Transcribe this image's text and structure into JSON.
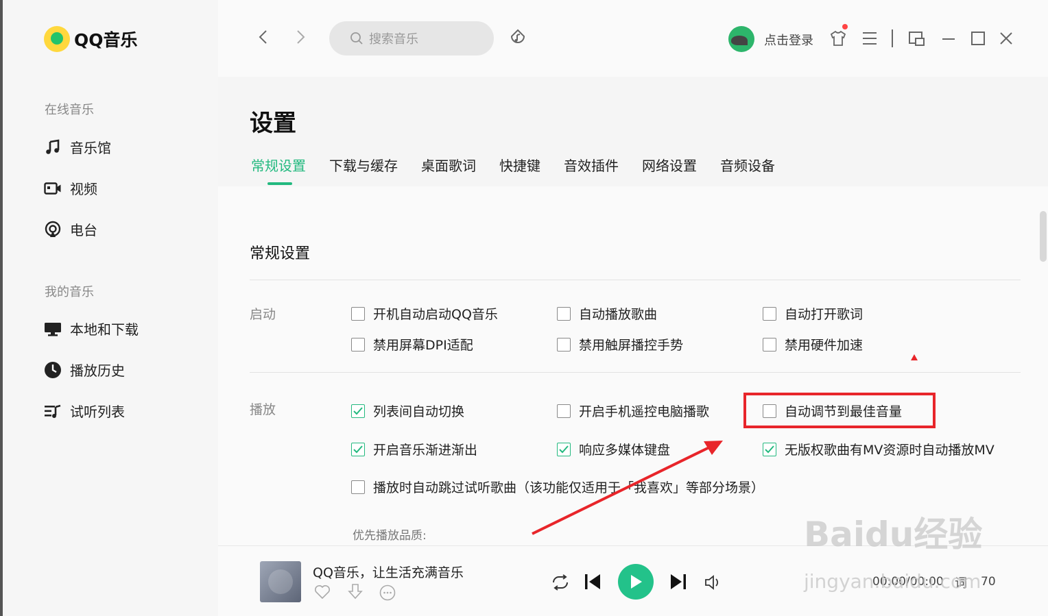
{
  "app": {
    "name": "QQ音乐"
  },
  "sidebar": {
    "online_title": "在线音乐",
    "online_items": [
      {
        "label": "音乐馆",
        "icon": "music-note-icon"
      },
      {
        "label": "视频",
        "icon": "video-icon"
      },
      {
        "label": "电台",
        "icon": "radio-icon"
      }
    ],
    "mine_title": "我的音乐",
    "mine_items": [
      {
        "label": "本地和下载",
        "icon": "monitor-icon"
      },
      {
        "label": "播放历史",
        "icon": "clock-icon"
      },
      {
        "label": "试听列表",
        "icon": "playlist-icon"
      }
    ]
  },
  "topbar": {
    "search_placeholder": "搜索音乐",
    "login_label": "点击登录"
  },
  "settings": {
    "title": "设置",
    "tabs": [
      "常规设置",
      "下载与缓存",
      "桌面歌词",
      "快捷键",
      "音效插件",
      "网络设置",
      "音频设备"
    ],
    "active_tab": "常规设置",
    "section_title": "常规设置",
    "startup": {
      "label": "启动",
      "options": [
        {
          "label": "开机自动启动QQ音乐",
          "checked": false
        },
        {
          "label": "自动播放歌曲",
          "checked": false
        },
        {
          "label": "自动打开歌词",
          "checked": false
        },
        {
          "label": "禁用屏幕DPI适配",
          "checked": false
        },
        {
          "label": "禁用触屏播控手势",
          "checked": false
        },
        {
          "label": "禁用硬件加速",
          "checked": false
        }
      ]
    },
    "playback": {
      "label": "播放",
      "options": [
        {
          "label": "列表间自动切换",
          "checked": true
        },
        {
          "label": "开启手机遥控电脑播歌",
          "checked": false
        },
        {
          "label": "自动调节到最佳音量",
          "checked": false
        },
        {
          "label": "开启音乐渐进渐出",
          "checked": true
        },
        {
          "label": "响应多媒体键盘",
          "checked": true
        },
        {
          "label": "无版权歌曲有MV资源时自动播放MV",
          "checked": true
        },
        {
          "label": "播放时自动跳过试听歌曲（该功能仅适用于「我喜欢」等部分场景）",
          "checked": false
        }
      ],
      "quality_label": "优先播放品质:"
    }
  },
  "player": {
    "song_title": "QQ音乐，让生活充满音乐",
    "time": "00:00/00:00",
    "lyric_label": "词",
    "count": "70"
  },
  "watermark": {
    "brand": "Baidu经验",
    "url": "jingyan.baidu.com"
  },
  "colors": {
    "accent": "#23b97f",
    "highlight": "#e8252a"
  }
}
